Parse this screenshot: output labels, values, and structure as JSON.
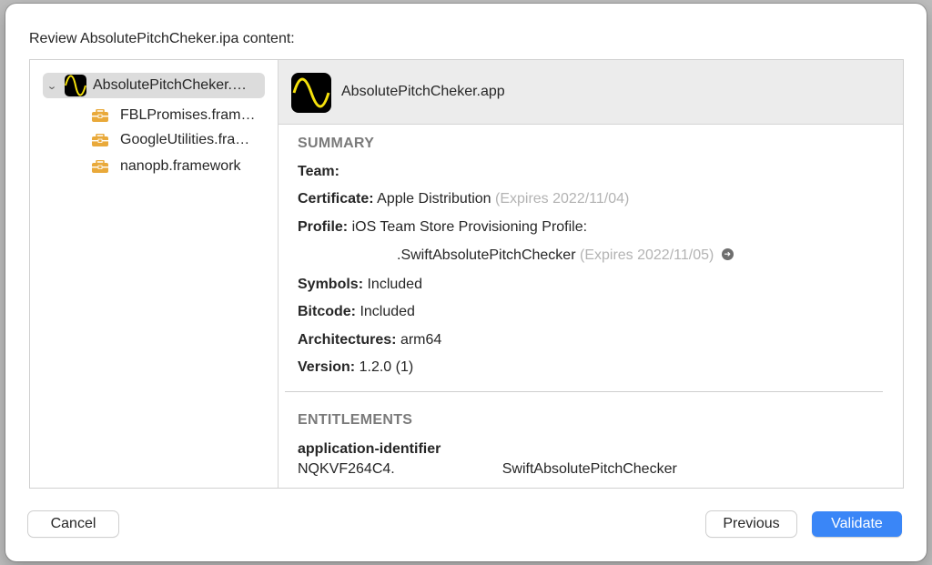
{
  "dialog": {
    "title": "Review AbsolutePitchCheker.ipa content:"
  },
  "sidebar": {
    "root": {
      "label": "AbsolutePitchCheker.app",
      "icon": "app-wave-icon",
      "expanded": true
    },
    "children": [
      {
        "label": "FBLPromises.framework",
        "icon": "toolbox-icon"
      },
      {
        "label": "GoogleUtilities.framework",
        "icon": "toolbox-icon"
      },
      {
        "label": "nanopb.framework",
        "icon": "toolbox-icon"
      }
    ]
  },
  "detail": {
    "header_title": "AbsolutePitchCheker.app",
    "summary": {
      "heading": "SUMMARY",
      "team_label": "Team:",
      "team_value": "",
      "certificate_label": "Certificate:",
      "certificate_value": "Apple Distribution",
      "certificate_expires": "(Expires 2022/11/04)",
      "profile_label": "Profile:",
      "profile_value": "iOS Team Store Provisioning Profile:",
      "profile_bundle": ".SwiftAbsolutePitchChecker",
      "profile_expires": "(Expires 2022/11/05)",
      "symbols_label": "Symbols:",
      "symbols_value": "Included",
      "bitcode_label": "Bitcode:",
      "bitcode_value": "Included",
      "architectures_label": "Architectures:",
      "architectures_value": "arm64",
      "version_label": "Version:",
      "version_value": "1.2.0 (1)"
    },
    "entitlements": {
      "heading": "ENTITLEMENTS",
      "key": "application-identifier",
      "value_prefix": "NQKVF264C4.",
      "value_suffix": "SwiftAbsolutePitchChecker"
    }
  },
  "buttons": {
    "cancel": "Cancel",
    "previous": "Previous",
    "validate": "Validate"
  },
  "colors": {
    "accent": "#3a86f7",
    "wave": "#f5e10c",
    "toolbox": "#e9a93a"
  }
}
